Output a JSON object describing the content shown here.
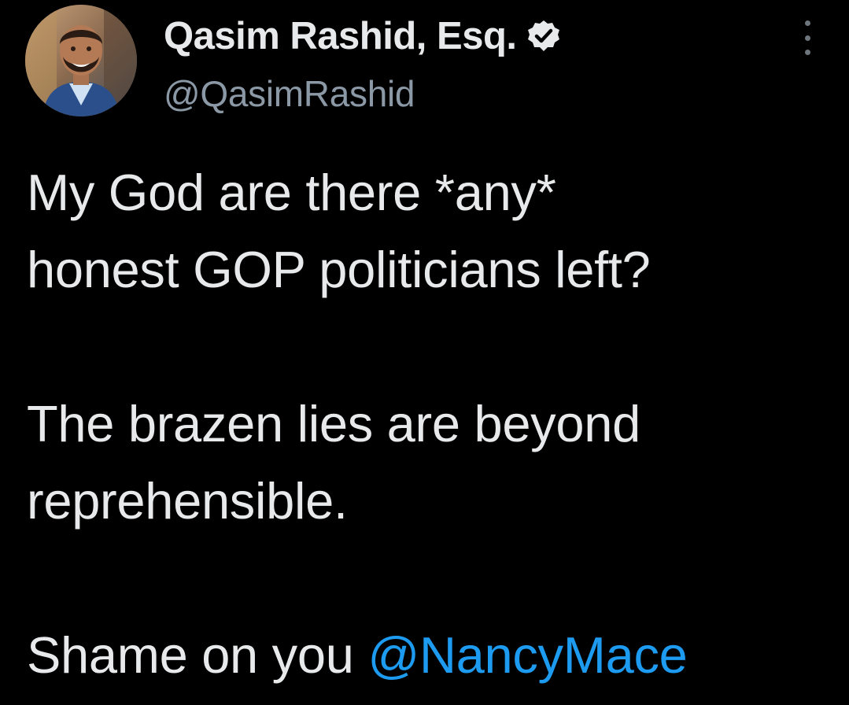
{
  "author": {
    "display_name": "Qasim Rashid, Esq.",
    "handle": "@QasimRashid",
    "verified": true,
    "avatar_icon": "profile-photo"
  },
  "menu": {
    "icon": "more-vertical-icon"
  },
  "tweet": {
    "line1": "My God are there *any*",
    "line2": "honest GOP politicians left?",
    "line3": "The brazen lies are beyond",
    "line4": "reprehensible.",
    "line5_prefix": "Shame on you ",
    "mention": "@NancyMace"
  },
  "colors": {
    "background": "#000000",
    "text": "#e7e9ea",
    "secondary": "#8b98a5",
    "link": "#1d9bf0"
  }
}
